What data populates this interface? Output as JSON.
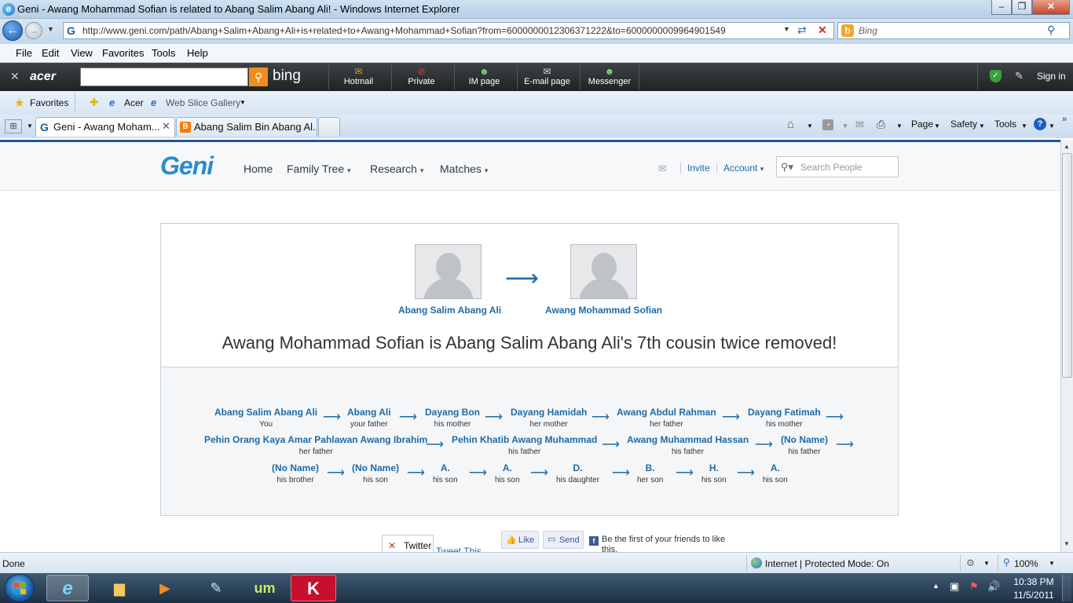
{
  "window": {
    "title": "Geni - Awang Mohammad Sofian is related to Abang Salim Abang Ali! - Windows Internet Explorer",
    "url": "http://www.geni.com/path/Abang+Salim+Abang+Ali+is+related+to+Awang+Mohammad+Sofian?from=6000000012306371222&to=6000000009964901549",
    "search_placeholder": "Bing"
  },
  "menu": [
    "File",
    "Edit",
    "View",
    "Favorites",
    "Tools",
    "Help"
  ],
  "acer_toolbar": {
    "brand": "acer",
    "bing": "bing",
    "buttons": [
      "Hotmail",
      "Private",
      "IM page",
      "E-mail page",
      "Messenger"
    ],
    "sign_in": "Sign in"
  },
  "favorites_bar": {
    "favorites": "Favorites",
    "items": [
      "Acer",
      "Web Slice Gallery"
    ]
  },
  "tabs": [
    {
      "label": "Geni - Awang Moham...",
      "active": true
    },
    {
      "label": "Abang Salim Bin Abang Al...",
      "active": false
    }
  ],
  "command_bar": [
    "Page",
    "Safety",
    "Tools"
  ],
  "geni": {
    "logo": "Geni",
    "nav": [
      "Home",
      "Family Tree",
      "Research",
      "Matches"
    ],
    "invite": "Invite",
    "account": "Account",
    "search_placeholder": "Search People",
    "from_person": "Abang Salim Abang Ali",
    "to_person": "Awang Mohammad Sofian",
    "headline": "Awang Mohammad Sofian is Abang Salim Abang Ali's 7th cousin twice removed!",
    "path_rows": [
      [
        {
          "name": "Abang Salim Abang Ali",
          "rel": "You"
        },
        {
          "name": "Abang Ali",
          "rel": "your father"
        },
        {
          "name": "Dayang Bon",
          "rel": "his mother"
        },
        {
          "name": "Dayang Hamidah",
          "rel": "her mother"
        },
        {
          "name": "Awang Abdul Rahman",
          "rel": "her father"
        },
        {
          "name": "Dayang Fatimah",
          "rel": "his mother"
        }
      ],
      [
        {
          "name": "Pehin Orang Kaya Amar Pahlawan Awang Ibrahim",
          "rel": "her father"
        },
        {
          "name": "Pehin Khatib Awang Muhammad",
          "rel": "his father"
        },
        {
          "name": "Awang Muhammad Hassan",
          "rel": "his father"
        },
        {
          "name": "(No Name)",
          "rel": "his father"
        }
      ],
      [
        {
          "name": "(No Name)",
          "rel": "his brother"
        },
        {
          "name": "(No Name)",
          "rel": "his son"
        },
        {
          "name": "A.",
          "rel": "his son"
        },
        {
          "name": "A.",
          "rel": "his son"
        },
        {
          "name": "D.",
          "rel": "his daughter"
        },
        {
          "name": "B.",
          "rel": "her son"
        },
        {
          "name": "H.",
          "rel": "his son"
        },
        {
          "name": "A.",
          "rel": "his son"
        }
      ]
    ],
    "social": {
      "twitter": "Twitter",
      "tweet": "Tweet This",
      "like": "Like",
      "send": "Send",
      "fb_text": "Be the first of your friends to like this."
    }
  },
  "status": {
    "left": "Done",
    "zone": "Internet | Protected Mode: On",
    "zoom": "100%"
  },
  "clock": {
    "time": "10:38 PM",
    "date": "11/5/2011"
  }
}
